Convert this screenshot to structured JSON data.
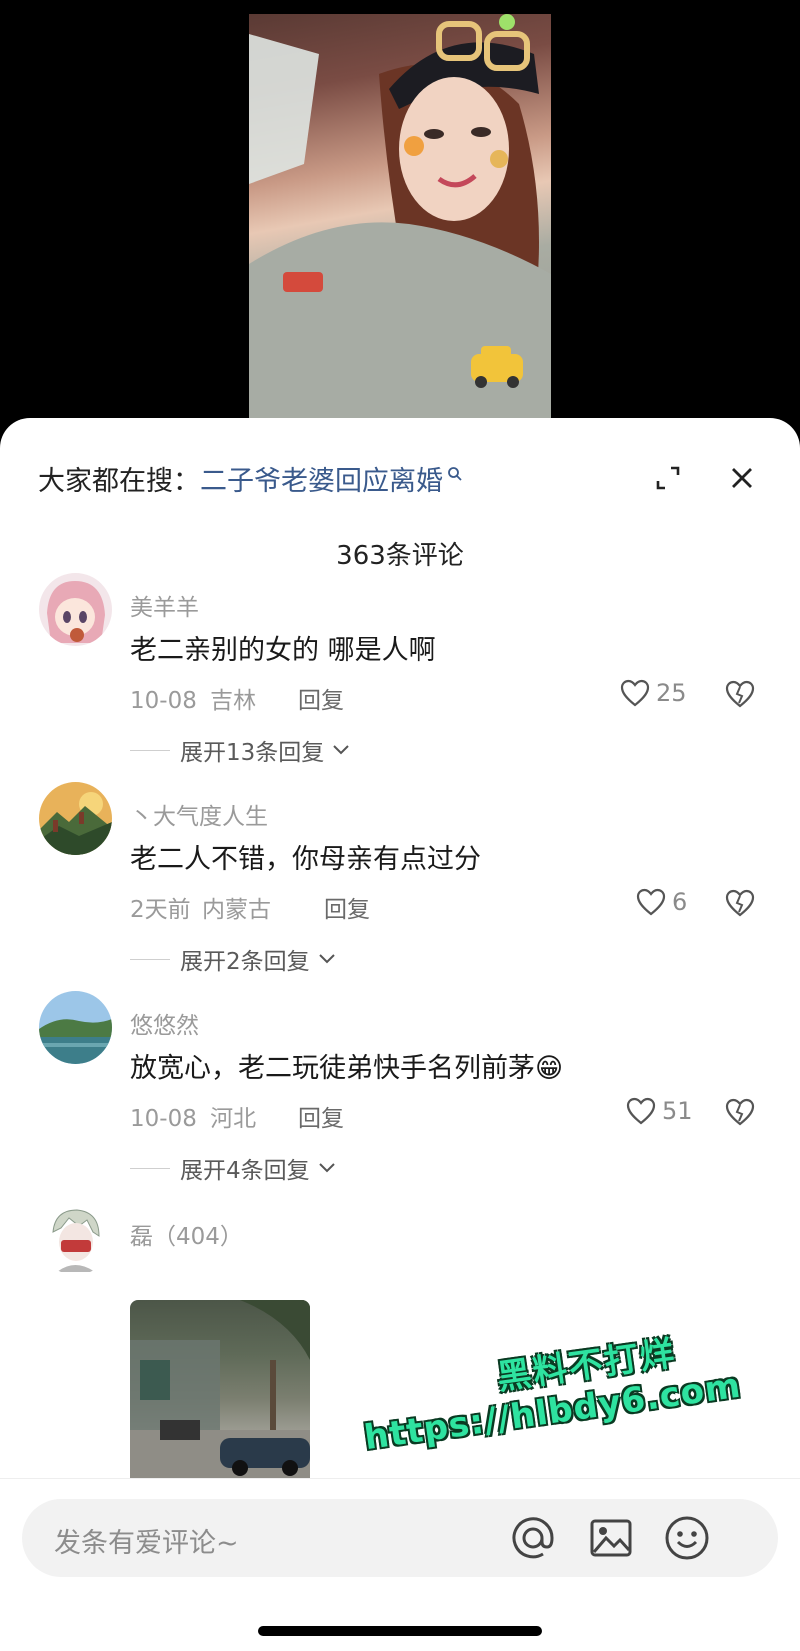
{
  "search": {
    "prefix": "大家都在搜：",
    "term": "二子爷老婆回应离婚"
  },
  "comment_count": "363条评论",
  "comments": [
    {
      "user": "美羊羊",
      "text": "老二亲别的女的 哪是人啊",
      "date": "10-08",
      "location": "吉林",
      "reply": "回复",
      "likes": "25",
      "expand": "展开13条回复"
    },
    {
      "user": "丶大气度人生",
      "text": "老二人不错，你母亲有点过分",
      "date": "2天前",
      "location": "内蒙古",
      "reply": "回复",
      "likes": "6",
      "expand": "展开2条回复"
    },
    {
      "user": "悠悠然",
      "text": "放宽心，老二玩徒弟快手名列前茅😁",
      "date": "10-08",
      "location": "河北",
      "reply": "回复",
      "likes": "51",
      "expand": "展开4条回复"
    },
    {
      "user": "磊（404）"
    }
  ],
  "watermark": {
    "line1": "黑料不打烊",
    "line2": "https://hlbdy6.com"
  },
  "input": {
    "placeholder": "发条有爱评论~"
  },
  "icons": [
    "search-icon",
    "expand-icon",
    "close-icon",
    "heart-icon",
    "dislike-icon",
    "chevron-down-icon",
    "at-icon",
    "image-icon",
    "emoji-icon"
  ],
  "colors": {
    "search_link": "#3a5a8c",
    "watermark": "#2ee3a0"
  }
}
